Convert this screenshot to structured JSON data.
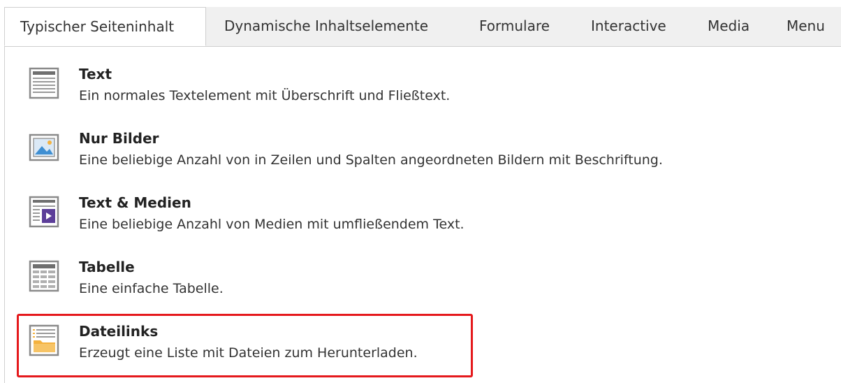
{
  "tabs": [
    {
      "label": "Typischer Seiteninhalt",
      "active": true
    },
    {
      "label": "Dynamische Inhaltselemente",
      "active": false
    },
    {
      "label": "Formulare",
      "active": false
    },
    {
      "label": "Interactive",
      "active": false
    },
    {
      "label": "Media",
      "active": false
    },
    {
      "label": "Menu",
      "active": false
    }
  ],
  "items": [
    {
      "title": "Text",
      "description": "Ein normales Textelement mit Überschrift und Fließtext.",
      "icon": "text-icon"
    },
    {
      "title": "Nur Bilder",
      "description": "Eine beliebige Anzahl von in Zeilen und Spalten angeordneten Bildern mit Beschriftung.",
      "icon": "images-icon"
    },
    {
      "title": "Text & Medien",
      "description": "Eine beliebige Anzahl von Medien mit umfließendem Text.",
      "icon": "text-media-icon"
    },
    {
      "title": "Tabelle",
      "description": "Eine einfache Tabelle.",
      "icon": "table-icon"
    },
    {
      "title": "Dateilinks",
      "description": "Erzeugt eine Liste mit Dateien zum Herunterladen.",
      "icon": "file-links-icon",
      "highlighted": true
    }
  ],
  "colors": {
    "highlight": "#e5191c",
    "media_purple": "#5c3e99",
    "folder_orange": "#f4b23f",
    "icon_gray": "#8a8a8a"
  }
}
